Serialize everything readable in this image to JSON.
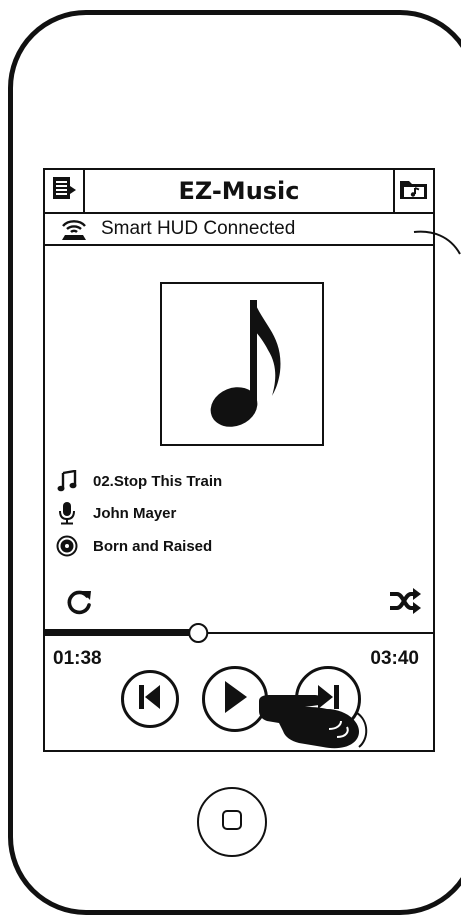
{
  "app": {
    "title": "EZ-Music"
  },
  "status": {
    "text": "Smart HUD Connected"
  },
  "track": {
    "title": "02.Stop This Train",
    "artist": "John Mayer",
    "album": "Born and Raised"
  },
  "player": {
    "elapsed": "01:38",
    "duration": "03:40",
    "progress_fraction": 0.395
  },
  "icons": {
    "playlist": "playlist-icon",
    "folder": "music-folder-icon",
    "hud": "hud-signal-icon",
    "note": "music-note-icon",
    "mic": "microphone-icon",
    "album": "album-disc-icon",
    "repeat": "repeat-icon",
    "shuffle": "shuffle-icon",
    "prev": "previous-track-icon",
    "play": "play-icon",
    "next": "next-track-icon",
    "hand": "pointing-hand-icon"
  },
  "colors": {
    "ink": "#111111",
    "background": "#ffffff"
  }
}
